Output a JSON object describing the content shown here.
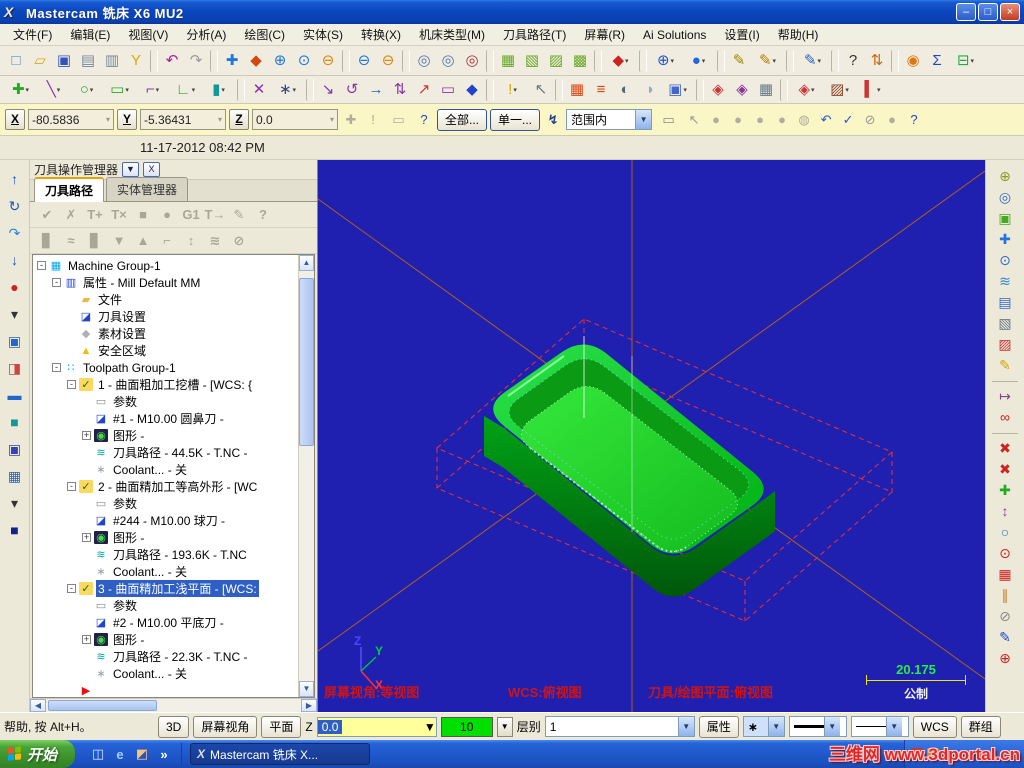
{
  "window": {
    "title": "Mastercam 铣床 X6 MU2",
    "logo_glyph": "X",
    "controls": {
      "minimize": "–",
      "maximize": "□",
      "close": "×"
    }
  },
  "menubar": {
    "items": [
      {
        "label": "文件(F)"
      },
      {
        "label": "编辑(E)"
      },
      {
        "label": "视图(V)"
      },
      {
        "label": "分析(A)"
      },
      {
        "label": "绘图(C)"
      },
      {
        "label": "实体(S)"
      },
      {
        "label": "转换(X)"
      },
      {
        "label": "机床类型(M)"
      },
      {
        "label": "刀具路径(T)"
      },
      {
        "label": "屏幕(R)"
      },
      {
        "label": "Ai Solutions"
      },
      {
        "label": "设置(I)"
      },
      {
        "label": "帮助(H)"
      }
    ]
  },
  "toolbar1": {
    "items": [
      {
        "n": "new-file-icon",
        "g": "□",
        "c": "#5588cc"
      },
      {
        "n": "open-file-icon",
        "g": "▱",
        "c": "#dda822"
      },
      {
        "n": "save-file-icon",
        "g": "▣",
        "c": "#3355bb"
      },
      {
        "n": "print-icon",
        "g": "▤",
        "c": "#778899"
      },
      {
        "n": "print-preview-icon",
        "g": "▥",
        "c": "#778899"
      },
      {
        "n": "filter-icon",
        "g": "Y",
        "c": "#dda800"
      },
      {
        "sep": true
      },
      {
        "n": "undo-icon",
        "g": "↶",
        "c": "#b01898"
      },
      {
        "n": "redo-icon",
        "g": "↷",
        "c": "#9a9a9a"
      },
      {
        "sep": true
      },
      {
        "n": "pan-icon",
        "g": "✚",
        "c": "#2277dd"
      },
      {
        "n": "dynamic-rotate-icon",
        "g": "◆",
        "c": "#d04a10"
      },
      {
        "n": "zoom-in-icon",
        "g": "⊕",
        "c": "#2277dd"
      },
      {
        "n": "zoom-window-icon",
        "g": "⊙",
        "c": "#2277dd"
      },
      {
        "n": "zoom-minus-icon",
        "g": "⊖",
        "c": "#dd8811"
      },
      {
        "sep": true
      },
      {
        "n": "zoom-selected-icon",
        "g": "⊖",
        "c": "#2277dd"
      },
      {
        "n": "zoom-out-icon",
        "g": "⊖",
        "c": "#dd8811"
      },
      {
        "sep": true
      },
      {
        "n": "repaint-icon",
        "g": "◎",
        "c": "#5577aa"
      },
      {
        "n": "regenerate-icon",
        "g": "◎",
        "c": "#5577aa"
      },
      {
        "n": "find-icon",
        "g": "◎",
        "c": "#aa3333"
      },
      {
        "sep": true
      },
      {
        "n": "solid-extrude-icon",
        "g": "▦",
        "c": "#66a822"
      },
      {
        "n": "solid-revolve-icon",
        "g": "▧",
        "c": "#66a822"
      },
      {
        "n": "solid-sweep-icon",
        "g": "▨",
        "c": "#66a822"
      },
      {
        "n": "solid-loft-icon",
        "g": "▩",
        "c": "#66a822"
      },
      {
        "sep": true
      },
      {
        "n": "gview-cube-icon",
        "g": "◆",
        "c": "#cc2222",
        "dd": true
      },
      {
        "sep": true
      },
      {
        "n": "globe-icon",
        "g": "⊕",
        "c": "#2255cc",
        "dd": true
      },
      {
        "n": "sphere-icon",
        "g": "●",
        "c": "#2266dd",
        "dd": true
      },
      {
        "sep": true
      },
      {
        "n": "pencil-icon",
        "g": "✎",
        "c": "#998800"
      },
      {
        "n": "pencils-icon",
        "g": "✎",
        "c": "#bb7700",
        "dd": true
      },
      {
        "sep": true
      },
      {
        "n": "edit-pencil-icon",
        "g": "✎",
        "c": "#2266cc",
        "dd": true
      },
      {
        "sep": true
      },
      {
        "n": "analyze-entity-icon",
        "g": "?",
        "c": "#333333"
      },
      {
        "n": "analyze-order-icon",
        "g": "⇅",
        "c": "#cc6611"
      },
      {
        "sep": true
      },
      {
        "n": "chain-icon",
        "g": "◉",
        "c": "#dd7711"
      },
      {
        "n": "sigma-icon",
        "g": "Σ",
        "c": "#2244cc"
      },
      {
        "n": "export-icon",
        "g": "⊟",
        "c": "#22aa44",
        "dd": true
      }
    ]
  },
  "toolbar2": {
    "items": [
      {
        "n": "create-point-icon",
        "g": "✚",
        "c": "#22aa22",
        "dd": true
      },
      {
        "n": "create-line-icon",
        "g": "╲",
        "c": "#8833aa",
        "dd": true
      },
      {
        "n": "create-circle-icon",
        "g": "○",
        "c": "#22aa22",
        "dd": true
      },
      {
        "n": "create-rect-icon",
        "g": "▭",
        "c": "#22aa22",
        "dd": true
      },
      {
        "n": "create-fillet-icon",
        "g": "⌐",
        "c": "#8833aa",
        "dd": true
      },
      {
        "n": "create-polyline-icon",
        "g": "∟",
        "c": "#22aa22",
        "dd": true
      },
      {
        "n": "create-cylinder-icon",
        "g": "▮",
        "c": "#119999",
        "dd": true
      },
      {
        "sep": true
      },
      {
        "n": "trim-icon",
        "g": "✕",
        "c": "#8833aa"
      },
      {
        "n": "pattern-icon",
        "g": "∗",
        "c": "#334488",
        "dd": true
      },
      {
        "sep": true
      },
      {
        "n": "xform-translate-icon",
        "g": "↘",
        "c": "#8833aa"
      },
      {
        "n": "xform-rotate-icon",
        "g": "↺",
        "c": "#8833aa"
      },
      {
        "n": "xform-mirror-icon",
        "g": "→",
        "c": "#2266cc"
      },
      {
        "n": "xform-offset-icon",
        "g": "⇅",
        "c": "#8833aa"
      },
      {
        "n": "xform-scale-icon",
        "g": "↗",
        "c": "#cc3344"
      },
      {
        "n": "xform-array-icon",
        "g": "▭",
        "c": "#8833aa"
      },
      {
        "n": "xform-project-icon",
        "g": "◆",
        "c": "#2244cc"
      },
      {
        "sep": true
      },
      {
        "n": "shade-settings-icon",
        "g": "!",
        "c": "#dda800",
        "dd": true
      },
      {
        "n": "selection-arrow-icon",
        "g": "↖",
        "c": "#667788"
      },
      {
        "sep": true
      },
      {
        "n": "grid-red-icon",
        "g": "▦",
        "c": "#dd4411"
      },
      {
        "n": "lines-red-icon",
        "g": "≡",
        "c": "#dd4411"
      },
      {
        "n": "shade-half-icon",
        "g": "◐",
        "c": "#556677"
      },
      {
        "n": "shade-tube-icon",
        "g": "◑",
        "c": "#99aacc"
      },
      {
        "n": "shade-box-icon",
        "g": "▣",
        "c": "#4466cc",
        "dd": true
      },
      {
        "sep": true
      },
      {
        "n": "paste-view-icon",
        "g": "◈",
        "c": "#cc3333"
      },
      {
        "n": "paste-wcs-icon",
        "g": "◈",
        "c": "#883399"
      },
      {
        "n": "view-grid-icon",
        "g": "▦",
        "c": "#667788"
      },
      {
        "sep": true
      },
      {
        "n": "gview-select-icon",
        "g": "◈",
        "c": "#cc3333",
        "dd": true
      },
      {
        "n": "wcs-select-icon",
        "g": "▨",
        "c": "#884422",
        "dd": true
      },
      {
        "n": "plane-select-icon",
        "g": "▍",
        "c": "#cc3333",
        "dd": true
      }
    ]
  },
  "coordbar": {
    "x_label": "X",
    "x_value": "-80.5836",
    "y_label": "Y",
    "y_value": "-5.36431",
    "z_label": "Z",
    "z_value": "0.0",
    "mid_icons": [
      {
        "n": "autocursor-config-icon",
        "g": "✚",
        "c": "#b0ac9e"
      },
      {
        "n": "fastpoint-icon",
        "g": "!",
        "c": "#b0ac9e"
      },
      {
        "n": "cursor-mode-icon",
        "g": "▭",
        "c": "#b0ac9e",
        "dd": true
      },
      {
        "n": "autocursor-help-icon",
        "g": "?",
        "c": "#2244cc"
      }
    ],
    "all_button": "全部...",
    "single_button": "单一...",
    "lightning_cursor": {
      "n": "quick-select-icon",
      "g": "↯",
      "c": "#334"
    },
    "range_value": "范围内",
    "right_icons": [
      {
        "n": "window-select-icon",
        "g": "▭",
        "c": "#888888",
        "dd": true
      },
      {
        "n": "pointer-icon",
        "g": "↖",
        "c": "#999999"
      },
      {
        "n": "select-solid-icon",
        "g": "●",
        "c": "#b0ac9e"
      },
      {
        "n": "select-face-icon",
        "g": "●",
        "c": "#b0ac9e"
      },
      {
        "n": "select-body-icon",
        "g": "●",
        "c": "#b0ac9e"
      },
      {
        "n": "select-back-icon",
        "g": "●",
        "c": "#b0ac9e"
      },
      {
        "n": "select-sphere-icon",
        "g": "◍",
        "c": "#b0ac9e"
      },
      {
        "n": "undo-select-icon",
        "g": "↶",
        "c": "#2255dd"
      },
      {
        "n": "end-selection-icon",
        "g": "✓",
        "c": "#2255dd"
      },
      {
        "n": "clear-selection-icon",
        "g": "⊘",
        "c": "#999999"
      },
      {
        "n": "extra-select-icon",
        "g": "●",
        "c": "#b0ac9e"
      },
      {
        "n": "selection-help-icon",
        "g": "?",
        "c": "#2244cc"
      }
    ]
  },
  "datebar": {
    "datetime": "11-17-2012 08:42 PM"
  },
  "left_toolbar": {
    "items": [
      {
        "n": "mru-up-icon",
        "g": "↑",
        "c": "#1155cc"
      },
      {
        "n": "mru-redo-icon",
        "g": "↻",
        "c": "#1155cc"
      },
      {
        "n": "mru-curve-icon",
        "g": "↷",
        "c": "#2288dd"
      },
      {
        "n": "mru-down-icon",
        "g": "↓",
        "c": "#1155cc"
      },
      {
        "n": "mru-point-icon",
        "g": "●",
        "c": "#cc2222"
      },
      {
        "n": "overflow-arrow-icon",
        "g": "▾",
        "c": "#333333"
      },
      {
        "n": "mru-screen-icon",
        "g": "▣",
        "c": "#2266cc"
      },
      {
        "n": "mru-half-icon",
        "g": "◨",
        "c": "#cc4444"
      },
      {
        "n": "mru-bar-icon",
        "g": "▬",
        "c": "#2266cc"
      },
      {
        "n": "mru-box-teal-icon",
        "g": "■",
        "c": "#119999"
      },
      {
        "n": "mru-box-blue-icon",
        "g": "▣",
        "c": "#3344bb"
      },
      {
        "n": "mru-grid-icon",
        "g": "▦",
        "c": "#2266cc"
      },
      {
        "n": "overflow-arrow2-icon",
        "g": "▾",
        "c": "#333333"
      },
      {
        "n": "mru-dark-icon",
        "g": "■",
        "c": "#112288"
      }
    ]
  },
  "right_toolbar": {
    "items": [
      {
        "n": "gview-isometric-icon",
        "g": "⊕",
        "c": "#8a9a20"
      },
      {
        "n": "analyze-view-icon",
        "g": "◎",
        "c": "#3366cc"
      },
      {
        "n": "shaded-view-icon",
        "g": "▣",
        "c": "#44aa22"
      },
      {
        "n": "fit-screen-icon",
        "g": "✚",
        "c": "#2277dd"
      },
      {
        "n": "zoom-window2-icon",
        "g": "⊙",
        "c": "#3366cc"
      },
      {
        "n": "blank-toolpath-icon",
        "g": "≋",
        "c": "#3388cc"
      },
      {
        "n": "layers-icon",
        "g": "▤",
        "c": "#3366cc"
      },
      {
        "n": "shade-settings2-icon",
        "g": "▧",
        "c": "#667788"
      },
      {
        "n": "material-icon",
        "g": "▨",
        "c": "#cc3333"
      },
      {
        "n": "pencil-edit-icon",
        "g": "✎",
        "c": "#ccaa00"
      },
      {
        "sep": true
      },
      {
        "n": "ref-point-icon",
        "g": "↦",
        "c": "#884488"
      },
      {
        "n": "stereo-glasses-icon",
        "g": "∞",
        "c": "#cc2222"
      },
      {
        "sep": true
      },
      {
        "n": "delete-entity-icon",
        "g": "✖",
        "c": "#cc2222"
      },
      {
        "n": "delete-dup-icon",
        "g": "✖",
        "c": "#cc2222"
      },
      {
        "n": "add-entity-icon",
        "g": "✚",
        "c": "#22aa22"
      },
      {
        "n": "swap-icon",
        "g": "↕",
        "c": "#8844aa"
      },
      {
        "n": "circle-tool-icon",
        "g": "○",
        "c": "#2277dd"
      },
      {
        "n": "target-blue-icon",
        "g": "⊙",
        "c": "#cc2222"
      },
      {
        "n": "grid-red2-icon",
        "g": "▦",
        "c": "#cc2222"
      },
      {
        "n": "pause-icon",
        "g": "∥",
        "c": "#cc7722"
      },
      {
        "n": "prohibit-icon",
        "g": "⊘",
        "c": "#888888"
      },
      {
        "n": "pencil-blue-icon",
        "g": "✎",
        "c": "#2244cc"
      },
      {
        "n": "target-red-icon",
        "g": "⊕",
        "c": "#cc2222"
      }
    ]
  },
  "ops_panel": {
    "title": "刀具操作管理器",
    "collapse_glyph": "▼",
    "close_glyph": "X",
    "tabs": [
      {
        "label": "刀具路径",
        "active": true
      },
      {
        "label": "实体管理器",
        "active": false
      }
    ],
    "toolbar_row1": [
      {
        "n": "select-all-ops-icon",
        "g": "✔",
        "c": "#aba798"
      },
      {
        "n": "unselect-all-ops-icon",
        "g": "✗",
        "c": "#aba798"
      },
      {
        "n": "regen-selected-icon",
        "g": "T+",
        "c": "#aba798"
      },
      {
        "n": "regen-all-icon",
        "g": "T×",
        "c": "#aba798"
      },
      {
        "n": "backplot-icon",
        "g": "■",
        "c": "#aba798"
      },
      {
        "n": "verify-icon",
        "g": "●",
        "c": "#aba798"
      },
      {
        "n": "post-g1-icon",
        "g": "G1",
        "c": "#aba798"
      },
      {
        "n": "post-out-icon",
        "g": "T→",
        "c": "#aba798"
      },
      {
        "n": "feed-edit-icon",
        "g": "✎",
        "c": "#aba798"
      },
      {
        "n": "ops-help-icon",
        "g": "?",
        "c": "#aba798"
      }
    ],
    "toolbar_row2": [
      {
        "n": "lock-icon",
        "g": "▊",
        "c": "#aba798"
      },
      {
        "n": "toolpath-blank-icon",
        "g": "≈",
        "c": "#aba798"
      },
      {
        "n": "lock2-icon",
        "g": "▊",
        "c": "#aba798"
      },
      {
        "n": "move-down-icon",
        "g": "▼",
        "c": "#aba798"
      },
      {
        "n": "move-up-icon",
        "g": "▲",
        "c": "#aba798"
      },
      {
        "n": "insert-arrow-move-icon",
        "g": "⌐",
        "c": "#aba798"
      },
      {
        "n": "scroll-insert-icon",
        "g": "↕",
        "c": "#aba798"
      },
      {
        "n": "toolpath-display-icon",
        "g": "≋",
        "c": "#aba798"
      },
      {
        "n": "options-icon",
        "g": "⊘",
        "c": "#aba798"
      }
    ],
    "tree": [
      {
        "depth": 0,
        "exp": "-",
        "g": "▦",
        "c": "#00a8e8",
        "label": "Machine Group-1"
      },
      {
        "depth": 1,
        "exp": "-",
        "g": "▥",
        "c": "#2244cc",
        "label": "属性 - Mill Default MM"
      },
      {
        "depth": 2,
        "exp": "",
        "g": "▰",
        "c": "#e8b84a",
        "label": "文件"
      },
      {
        "depth": 2,
        "exp": "",
        "g": "◪",
        "c": "#2244cc",
        "label": "刀具设置"
      },
      {
        "depth": 2,
        "exp": "",
        "g": "◆",
        "c": "#b0b0b0",
        "label": "素材设置"
      },
      {
        "depth": 2,
        "exp": "",
        "g": "▲",
        "c": "#f0c000",
        "label": "安全区域"
      },
      {
        "depth": 1,
        "exp": "-",
        "g": "∷",
        "c": "#00b0b0",
        "label": "Toolpath Group-1"
      },
      {
        "depth": 2,
        "exp": "-",
        "g": "✓",
        "c": "#067800",
        "bg": "#ffd860",
        "label": "1 - 曲面粗加工挖槽 - [WCS: {"
      },
      {
        "depth": 3,
        "exp": "",
        "g": "▭",
        "c": "#888888",
        "label": "参数"
      },
      {
        "depth": 3,
        "exp": "",
        "g": "◪",
        "c": "#2244cc",
        "label": "#1 - M10.00 圆鼻刀 -"
      },
      {
        "depth": 3,
        "exp": "+",
        "g": "◉",
        "c": "#44dd44",
        "bg": "#202048",
        "label": "图形 -"
      },
      {
        "depth": 3,
        "exp": "",
        "g": "≋",
        "c": "#00a8a8",
        "label": "刀具路径 - 44.5K - T.NC -"
      },
      {
        "depth": 3,
        "exp": "",
        "g": "∗",
        "c": "#99a0a8",
        "label": "Coolant... - 关"
      },
      {
        "depth": 2,
        "exp": "-",
        "g": "✓",
        "c": "#067800",
        "bg": "#ffd860",
        "label": "2 - 曲面精加工等高外形 - [WC"
      },
      {
        "depth": 3,
        "exp": "",
        "g": "▭",
        "c": "#888888",
        "label": "参数"
      },
      {
        "depth": 3,
        "exp": "",
        "g": "◪",
        "c": "#2244cc",
        "label": "#244 - M10.00 球刀 -"
      },
      {
        "depth": 3,
        "exp": "+",
        "g": "◉",
        "c": "#44dd44",
        "bg": "#202048",
        "label": "图形 -"
      },
      {
        "depth": 3,
        "exp": "",
        "g": "≋",
        "c": "#00a8a8",
        "label": "刀具路径 - 193.6K - T.NC"
      },
      {
        "depth": 3,
        "exp": "",
        "g": "∗",
        "c": "#99a0a8",
        "label": "Coolant... - 关"
      },
      {
        "depth": 2,
        "exp": "-",
        "g": "✓",
        "c": "#067800",
        "bg": "#ffd860",
        "label": "3 - 曲面精加工浅平面 - [WCS:",
        "sel": true
      },
      {
        "depth": 3,
        "exp": "",
        "g": "▭",
        "c": "#888888",
        "label": "参数"
      },
      {
        "depth": 3,
        "exp": "",
        "g": "◪",
        "c": "#2244cc",
        "label": "#2 - M10.00 平底刀 -"
      },
      {
        "depth": 3,
        "exp": "+",
        "g": "◉",
        "c": "#44dd44",
        "bg": "#202048",
        "label": "图形 -"
      },
      {
        "depth": 3,
        "exp": "",
        "g": "≋",
        "c": "#00a8a8",
        "label": "刀具路径 - 22.3K - T.NC -"
      },
      {
        "depth": 3,
        "exp": "",
        "g": "∗",
        "c": "#99a0a8",
        "label": "Coolant... - 关"
      },
      {
        "depth": 2,
        "exp": "",
        "g": "▶",
        "c": "#e81010",
        "label": ""
      }
    ]
  },
  "viewport": {
    "gview_label": "屏幕视角:等视图",
    "wcs_label": "WCS:俯视图",
    "cplane_label": "刀具/绘图平面:俯视图",
    "scale": {
      "value": "20.175",
      "unit": "公制"
    },
    "axis_labels": {
      "x": "X",
      "y": "Y",
      "z": "Z"
    }
  },
  "statusbar": {
    "help_text": "帮助, 按 Alt+H。",
    "view_3d": "3D",
    "screen_view": "屏幕视角",
    "plane": "平面",
    "z_label": "Z",
    "z_value": "0.0",
    "feed_value": "10",
    "layer_label": "层别",
    "layer_value": "1",
    "attributes": "属性",
    "point_glyph": "∗",
    "wcs": "WCS",
    "group": "群组"
  },
  "taskbar": {
    "start": "开始",
    "quick_launch": [
      {
        "n": "show-desktop-icon",
        "g": "◫",
        "c": "#cfe0ff"
      },
      {
        "n": "browser-icon",
        "g": "e",
        "c": "#9fd0ff"
      },
      {
        "n": "media-icon",
        "g": "◩",
        "c": "#ffc080"
      },
      {
        "n": "chevron-icon",
        "g": "»",
        "c": "#ffffff"
      }
    ],
    "task_icon_glyph": "X",
    "task_label": "Mastercam 铣床 X...",
    "watermark": "三维网 www.3dportal.cn"
  }
}
